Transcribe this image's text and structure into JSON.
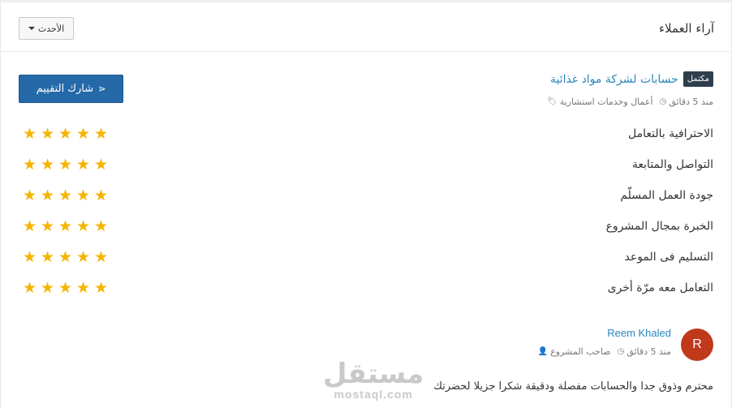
{
  "header": {
    "title": "آراء العملاء",
    "sort_label": "الأحدث"
  },
  "project": {
    "status_badge": "مكتمل",
    "title": "حسابات لشركة مواد غذائية",
    "category": "أعمال وخدمات استشارية",
    "time": "منذ 5 دقائق"
  },
  "share_label": "شارك التقييم",
  "ratings": [
    {
      "label": "الاحترافية بالتعامل",
      "stars": 5
    },
    {
      "label": "التواصل والمتابعة",
      "stars": 5
    },
    {
      "label": "جودة العمل المسلّم",
      "stars": 5
    },
    {
      "label": "الخبرة بمجال المشروع",
      "stars": 5
    },
    {
      "label": "التسليم فى الموعد",
      "stars": 5
    },
    {
      "label": "التعامل معه مرّة أخرى",
      "stars": 5
    }
  ],
  "review": {
    "avatar_letter": "R",
    "name": "Reem Khaled",
    "role": "صاحب المشروع",
    "time": "منذ 5 دقائق",
    "text": "محترم وذوق جدا والحسابات مفصلة ودقيقة شكرا جزيلا لحضرتك"
  },
  "watermark": {
    "arabic": "مستقل",
    "latin": "mostaql.com"
  },
  "colors": {
    "accent_link": "#2a87bd",
    "share_button": "#2569a8",
    "badge": "#2e3e4c",
    "star": "#f5b400",
    "avatar": "#c0391b"
  }
}
